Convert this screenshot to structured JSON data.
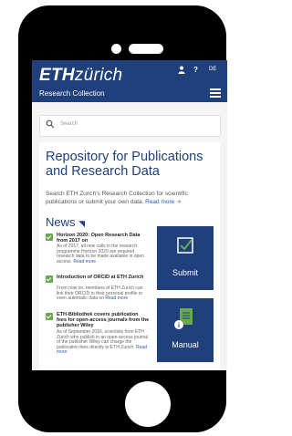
{
  "header": {
    "logo_bold": "ETH",
    "logo_light": "zürich",
    "subtitle": "Research Collection",
    "lang": "DE"
  },
  "search": {
    "placeholder": "Search"
  },
  "main": {
    "title": "Repository for Publications and Research Data",
    "intro": "Search ETH Zurich's Research Collection for scientific publications or submit your own data.",
    "read_more": "Read more",
    "arrow": "➔"
  },
  "news": {
    "heading": "News",
    "items": [
      {
        "title": "Horizon 2020: Open Research Data from 2017 on",
        "body": "As of 2017, all new calls in the research programme Horizon 2020 are required research data to be made available in open access.",
        "more": "Read more"
      },
      {
        "title": "Introduction of ORCID at ETH Zurich",
        "body": "From now on, members of ETH Zurich can link their ORCID to their personal profile or even automatic data on",
        "more": "Read more"
      },
      {
        "title": "ETH-Bibliothek covers publication fees for open-access journals from the publisher Wiley",
        "body": "As of September 2016, scientists from ETH Zurich who publish in an open-access journal of the publisher Wiley can charge the publication fees directly to ETH Zurich.",
        "more": "Read more"
      }
    ]
  },
  "tiles": {
    "submit": "Submit",
    "manual": "Manual"
  },
  "colors": {
    "brand": "#1f407a",
    "accent": "#6aa84f",
    "link": "#1f5ab4"
  }
}
